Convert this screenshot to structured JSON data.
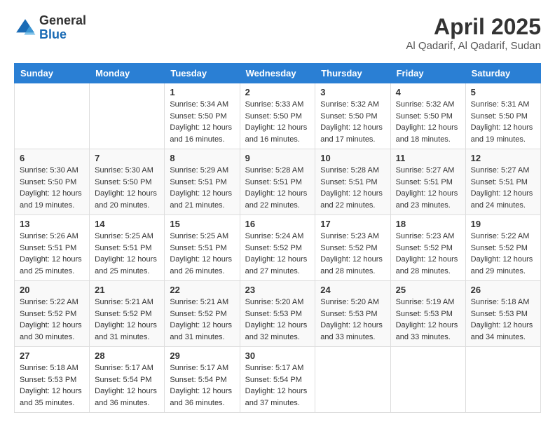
{
  "header": {
    "logo_line1": "General",
    "logo_line2": "Blue",
    "month_title": "April 2025",
    "location": "Al Qadarif, Al Qadarif, Sudan"
  },
  "weekdays": [
    "Sunday",
    "Monday",
    "Tuesday",
    "Wednesday",
    "Thursday",
    "Friday",
    "Saturday"
  ],
  "weeks": [
    [
      null,
      null,
      {
        "day": 1,
        "sunrise": "5:34 AM",
        "sunset": "5:50 PM",
        "daylight": "12 hours and 16 minutes."
      },
      {
        "day": 2,
        "sunrise": "5:33 AM",
        "sunset": "5:50 PM",
        "daylight": "12 hours and 16 minutes."
      },
      {
        "day": 3,
        "sunrise": "5:32 AM",
        "sunset": "5:50 PM",
        "daylight": "12 hours and 17 minutes."
      },
      {
        "day": 4,
        "sunrise": "5:32 AM",
        "sunset": "5:50 PM",
        "daylight": "12 hours and 18 minutes."
      },
      {
        "day": 5,
        "sunrise": "5:31 AM",
        "sunset": "5:50 PM",
        "daylight": "12 hours and 19 minutes."
      }
    ],
    [
      {
        "day": 6,
        "sunrise": "5:30 AM",
        "sunset": "5:50 PM",
        "daylight": "12 hours and 19 minutes."
      },
      {
        "day": 7,
        "sunrise": "5:30 AM",
        "sunset": "5:50 PM",
        "daylight": "12 hours and 20 minutes."
      },
      {
        "day": 8,
        "sunrise": "5:29 AM",
        "sunset": "5:51 PM",
        "daylight": "12 hours and 21 minutes."
      },
      {
        "day": 9,
        "sunrise": "5:28 AM",
        "sunset": "5:51 PM",
        "daylight": "12 hours and 22 minutes."
      },
      {
        "day": 10,
        "sunrise": "5:28 AM",
        "sunset": "5:51 PM",
        "daylight": "12 hours and 22 minutes."
      },
      {
        "day": 11,
        "sunrise": "5:27 AM",
        "sunset": "5:51 PM",
        "daylight": "12 hours and 23 minutes."
      },
      {
        "day": 12,
        "sunrise": "5:27 AM",
        "sunset": "5:51 PM",
        "daylight": "12 hours and 24 minutes."
      }
    ],
    [
      {
        "day": 13,
        "sunrise": "5:26 AM",
        "sunset": "5:51 PM",
        "daylight": "12 hours and 25 minutes."
      },
      {
        "day": 14,
        "sunrise": "5:25 AM",
        "sunset": "5:51 PM",
        "daylight": "12 hours and 25 minutes."
      },
      {
        "day": 15,
        "sunrise": "5:25 AM",
        "sunset": "5:51 PM",
        "daylight": "12 hours and 26 minutes."
      },
      {
        "day": 16,
        "sunrise": "5:24 AM",
        "sunset": "5:52 PM",
        "daylight": "12 hours and 27 minutes."
      },
      {
        "day": 17,
        "sunrise": "5:23 AM",
        "sunset": "5:52 PM",
        "daylight": "12 hours and 28 minutes."
      },
      {
        "day": 18,
        "sunrise": "5:23 AM",
        "sunset": "5:52 PM",
        "daylight": "12 hours and 28 minutes."
      },
      {
        "day": 19,
        "sunrise": "5:22 AM",
        "sunset": "5:52 PM",
        "daylight": "12 hours and 29 minutes."
      }
    ],
    [
      {
        "day": 20,
        "sunrise": "5:22 AM",
        "sunset": "5:52 PM",
        "daylight": "12 hours and 30 minutes."
      },
      {
        "day": 21,
        "sunrise": "5:21 AM",
        "sunset": "5:52 PM",
        "daylight": "12 hours and 31 minutes."
      },
      {
        "day": 22,
        "sunrise": "5:21 AM",
        "sunset": "5:52 PM",
        "daylight": "12 hours and 31 minutes."
      },
      {
        "day": 23,
        "sunrise": "5:20 AM",
        "sunset": "5:53 PM",
        "daylight": "12 hours and 32 minutes."
      },
      {
        "day": 24,
        "sunrise": "5:20 AM",
        "sunset": "5:53 PM",
        "daylight": "12 hours and 33 minutes."
      },
      {
        "day": 25,
        "sunrise": "5:19 AM",
        "sunset": "5:53 PM",
        "daylight": "12 hours and 33 minutes."
      },
      {
        "day": 26,
        "sunrise": "5:18 AM",
        "sunset": "5:53 PM",
        "daylight": "12 hours and 34 minutes."
      }
    ],
    [
      {
        "day": 27,
        "sunrise": "5:18 AM",
        "sunset": "5:53 PM",
        "daylight": "12 hours and 35 minutes."
      },
      {
        "day": 28,
        "sunrise": "5:17 AM",
        "sunset": "5:54 PM",
        "daylight": "12 hours and 36 minutes."
      },
      {
        "day": 29,
        "sunrise": "5:17 AM",
        "sunset": "5:54 PM",
        "daylight": "12 hours and 36 minutes."
      },
      {
        "day": 30,
        "sunrise": "5:17 AM",
        "sunset": "5:54 PM",
        "daylight": "12 hours and 37 minutes."
      },
      null,
      null,
      null
    ]
  ]
}
